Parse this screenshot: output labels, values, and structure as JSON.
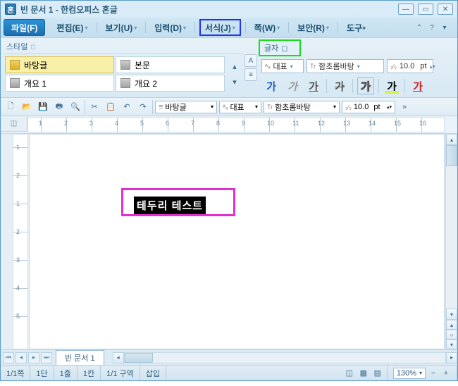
{
  "title": "빈 문서 1 - 한컴오피스 혼글",
  "menus": {
    "file": "파일(F)",
    "edit": "편집(E)",
    "view": "보기(U)",
    "input": "입력(D)",
    "format": "서식(J)",
    "page": "쪽(W)",
    "security": "보안(R)",
    "tools": "도구"
  },
  "styles": {
    "panel_title": "스타일",
    "items": [
      "바탕글",
      "본문",
      "개요 1",
      "개요 2"
    ]
  },
  "char_panel": {
    "title": "글자",
    "rep": "대표",
    "font": "함초롬바탕",
    "size": "10.0",
    "size_unit": "pt"
  },
  "format_icons": {
    "ga": "가"
  },
  "toolbar2": {
    "style": "바탕글",
    "rep": "대표",
    "font": "함초롬바탕",
    "size": "10.0",
    "size_unit": "pt"
  },
  "ruler": {
    "h": [
      "1",
      "2",
      "3",
      "4",
      "5",
      "6",
      "7",
      "8",
      "9",
      "10",
      "11",
      "12",
      "13",
      "14",
      "15",
      "16"
    ],
    "v": [
      "1",
      "2",
      "1",
      "2",
      "3",
      "4",
      "5"
    ]
  },
  "document": {
    "selected_text": "테두리 테스트"
  },
  "tabs": {
    "doc1": "빈 문서 1"
  },
  "status": {
    "page": "1/1쪽",
    "section": "1단",
    "line": "1줄",
    "col": "1칸",
    "area": "1/1 구역",
    "mode": "삽입",
    "zoom": "130%"
  }
}
